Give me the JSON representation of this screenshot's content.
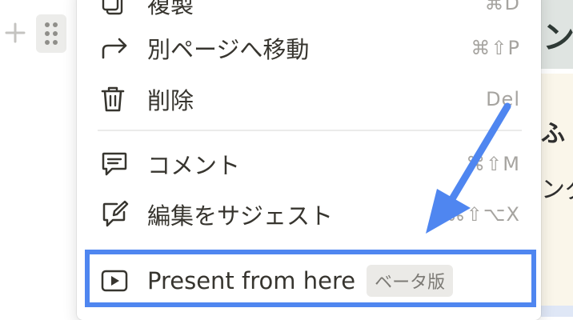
{
  "gutter": {
    "add_icon": "plus-icon",
    "drag_icon": "drag-handle-icon"
  },
  "menu": {
    "items": [
      {
        "label": "複製",
        "shortcut": "⌘D",
        "icon": "duplicate-icon"
      },
      {
        "label": "別ページへ移動",
        "shortcut": "⌘⇧P",
        "icon": "move-to-arrow-icon"
      },
      {
        "label": "削除",
        "shortcut": "Del",
        "icon": "trash-icon"
      },
      {
        "label": "コメント",
        "shortcut": "⌘⇧M",
        "icon": "comment-icon"
      },
      {
        "label": "編集をサジェスト",
        "shortcut": "⌘⇧⌥X",
        "icon": "suggest-edit-icon"
      }
    ],
    "present": {
      "label": "Present from here",
      "badge": "ベータ版",
      "icon": "play-icon"
    }
  },
  "page_peek": {
    "title_fragment": "ン",
    "callout_line1": "ふ",
    "callout_line2": "ング"
  },
  "colors": {
    "annotation_blue": "#4f86f0",
    "menu_text": "#37352f",
    "shortcut_text": "#a6a4a0",
    "badge_bg": "#ebeae7"
  }
}
